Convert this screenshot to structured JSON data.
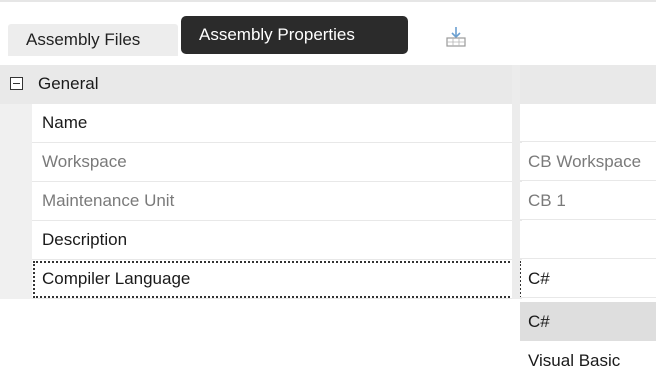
{
  "tabs": {
    "files_label": "Assembly Files",
    "properties_label": "Assembly Properties"
  },
  "property_grid": {
    "category": "General",
    "rows": [
      {
        "name": "Name",
        "value": "",
        "readonly": false
      },
      {
        "name": "Workspace",
        "value": "CB Workspace",
        "readonly": true
      },
      {
        "name": "Maintenance Unit",
        "value": "CB 1",
        "readonly": true
      },
      {
        "name": "Description",
        "value": "",
        "readonly": false
      },
      {
        "name": "Compiler Language",
        "value": "C#",
        "readonly": false,
        "focused": true
      }
    ]
  },
  "language_dropdown": {
    "options": [
      "C#",
      "Visual Basic"
    ],
    "selected": "C#"
  }
}
